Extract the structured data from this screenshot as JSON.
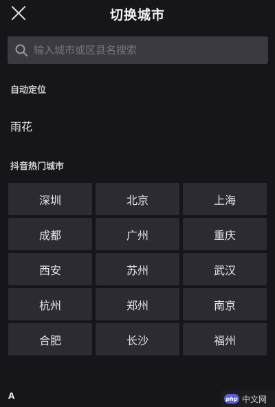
{
  "header": {
    "title": "切换城市",
    "close_icon": "close-icon"
  },
  "search": {
    "placeholder": "输入城市或区县名搜索",
    "value": "",
    "icon": "search-icon"
  },
  "auto_location": {
    "label": "自动定位",
    "city": "雨花"
  },
  "hot_cities": {
    "label": "抖音热门城市",
    "cities": [
      "深圳",
      "北京",
      "上海",
      "成都",
      "广州",
      "重庆",
      "西安",
      "苏州",
      "武汉",
      "杭州",
      "郑州",
      "南京",
      "合肥",
      "长沙",
      "福州"
    ]
  },
  "index": {
    "letter": "A"
  },
  "watermark": {
    "badge": "php",
    "text": "中文网"
  },
  "colors": {
    "background": "#161519",
    "search_bg": "#3b3a41",
    "cell_bg": "#2c2b31",
    "text": "#e8e8ea"
  }
}
